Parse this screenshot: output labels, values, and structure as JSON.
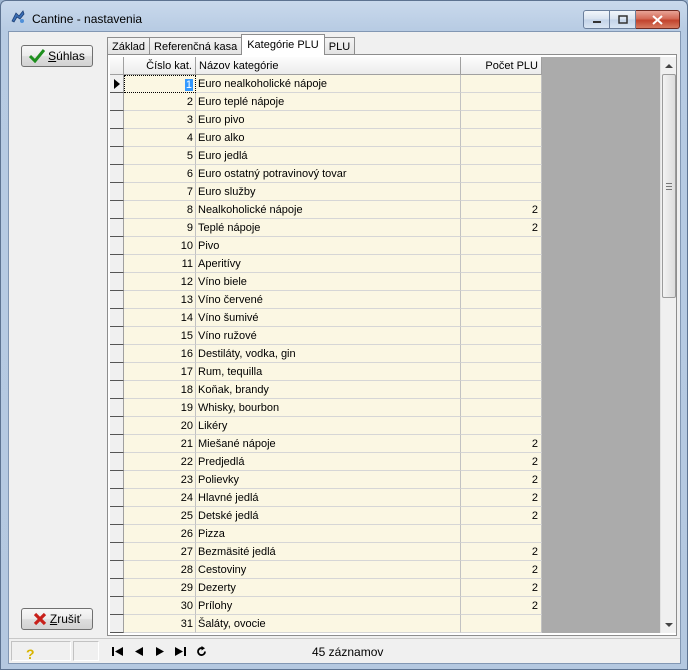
{
  "window": {
    "title": "Cantine - nastavenia"
  },
  "buttons": {
    "ok_label": "Súhlas",
    "ok_underline": "S",
    "ok_rest": "úhlas",
    "cancel_underline": "Z",
    "cancel_rest": "rušiť"
  },
  "tabs": [
    {
      "label": "Základ",
      "active": false
    },
    {
      "label": "Referenčná kasa",
      "active": false
    },
    {
      "label": "Kategórie PLU",
      "active": true
    },
    {
      "label": "PLU",
      "active": false
    }
  ],
  "grid": {
    "columns": [
      "Číslo kat.",
      "Názov kategórie",
      "Počet PLU"
    ],
    "selected_row": 0,
    "rows": [
      {
        "num": "1",
        "name": "Euro nealkoholické nápoje",
        "count": ""
      },
      {
        "num": "2",
        "name": "Euro teplé nápoje",
        "count": ""
      },
      {
        "num": "3",
        "name": "Euro pivo",
        "count": ""
      },
      {
        "num": "4",
        "name": "Euro alko",
        "count": ""
      },
      {
        "num": "5",
        "name": "Euro jedlá",
        "count": ""
      },
      {
        "num": "6",
        "name": "Euro ostatný potravinový tovar",
        "count": ""
      },
      {
        "num": "7",
        "name": "Euro služby",
        "count": ""
      },
      {
        "num": "8",
        "name": "Nealkoholické nápoje",
        "count": "2"
      },
      {
        "num": "9",
        "name": "Teplé nápoje",
        "count": "2"
      },
      {
        "num": "10",
        "name": "Pivo",
        "count": ""
      },
      {
        "num": "11",
        "name": "Aperitívy",
        "count": ""
      },
      {
        "num": "12",
        "name": "Víno biele",
        "count": ""
      },
      {
        "num": "13",
        "name": "Víno červené",
        "count": ""
      },
      {
        "num": "14",
        "name": "Víno šumivé",
        "count": ""
      },
      {
        "num": "15",
        "name": "Víno ružové",
        "count": ""
      },
      {
        "num": "16",
        "name": "Destiláty, vodka, gin",
        "count": ""
      },
      {
        "num": "17",
        "name": "Rum, tequilla",
        "count": ""
      },
      {
        "num": "18",
        "name": "Koňak, brandy",
        "count": ""
      },
      {
        "num": "19",
        "name": "Whisky, bourbon",
        "count": ""
      },
      {
        "num": "20",
        "name": "Likéry",
        "count": ""
      },
      {
        "num": "21",
        "name": "Miešané nápoje",
        "count": "2"
      },
      {
        "num": "22",
        "name": "Predjedlá",
        "count": "2"
      },
      {
        "num": "23",
        "name": "Polievky",
        "count": "2"
      },
      {
        "num": "24",
        "name": "Hlavné jedlá",
        "count": "2"
      },
      {
        "num": "25",
        "name": "Detské jedlá",
        "count": "2"
      },
      {
        "num": "26",
        "name": "Pizza",
        "count": ""
      },
      {
        "num": "27",
        "name": "Bezmäsité jedlá",
        "count": "2"
      },
      {
        "num": "28",
        "name": "Cestoviny",
        "count": "2"
      },
      {
        "num": "29",
        "name": "Dezerty",
        "count": "2"
      },
      {
        "num": "30",
        "name": "Prílohy",
        "count": "2"
      },
      {
        "num": "31",
        "name": "Šaláty, ovocie",
        "count": ""
      }
    ]
  },
  "status": {
    "records": "45 záznamov"
  }
}
